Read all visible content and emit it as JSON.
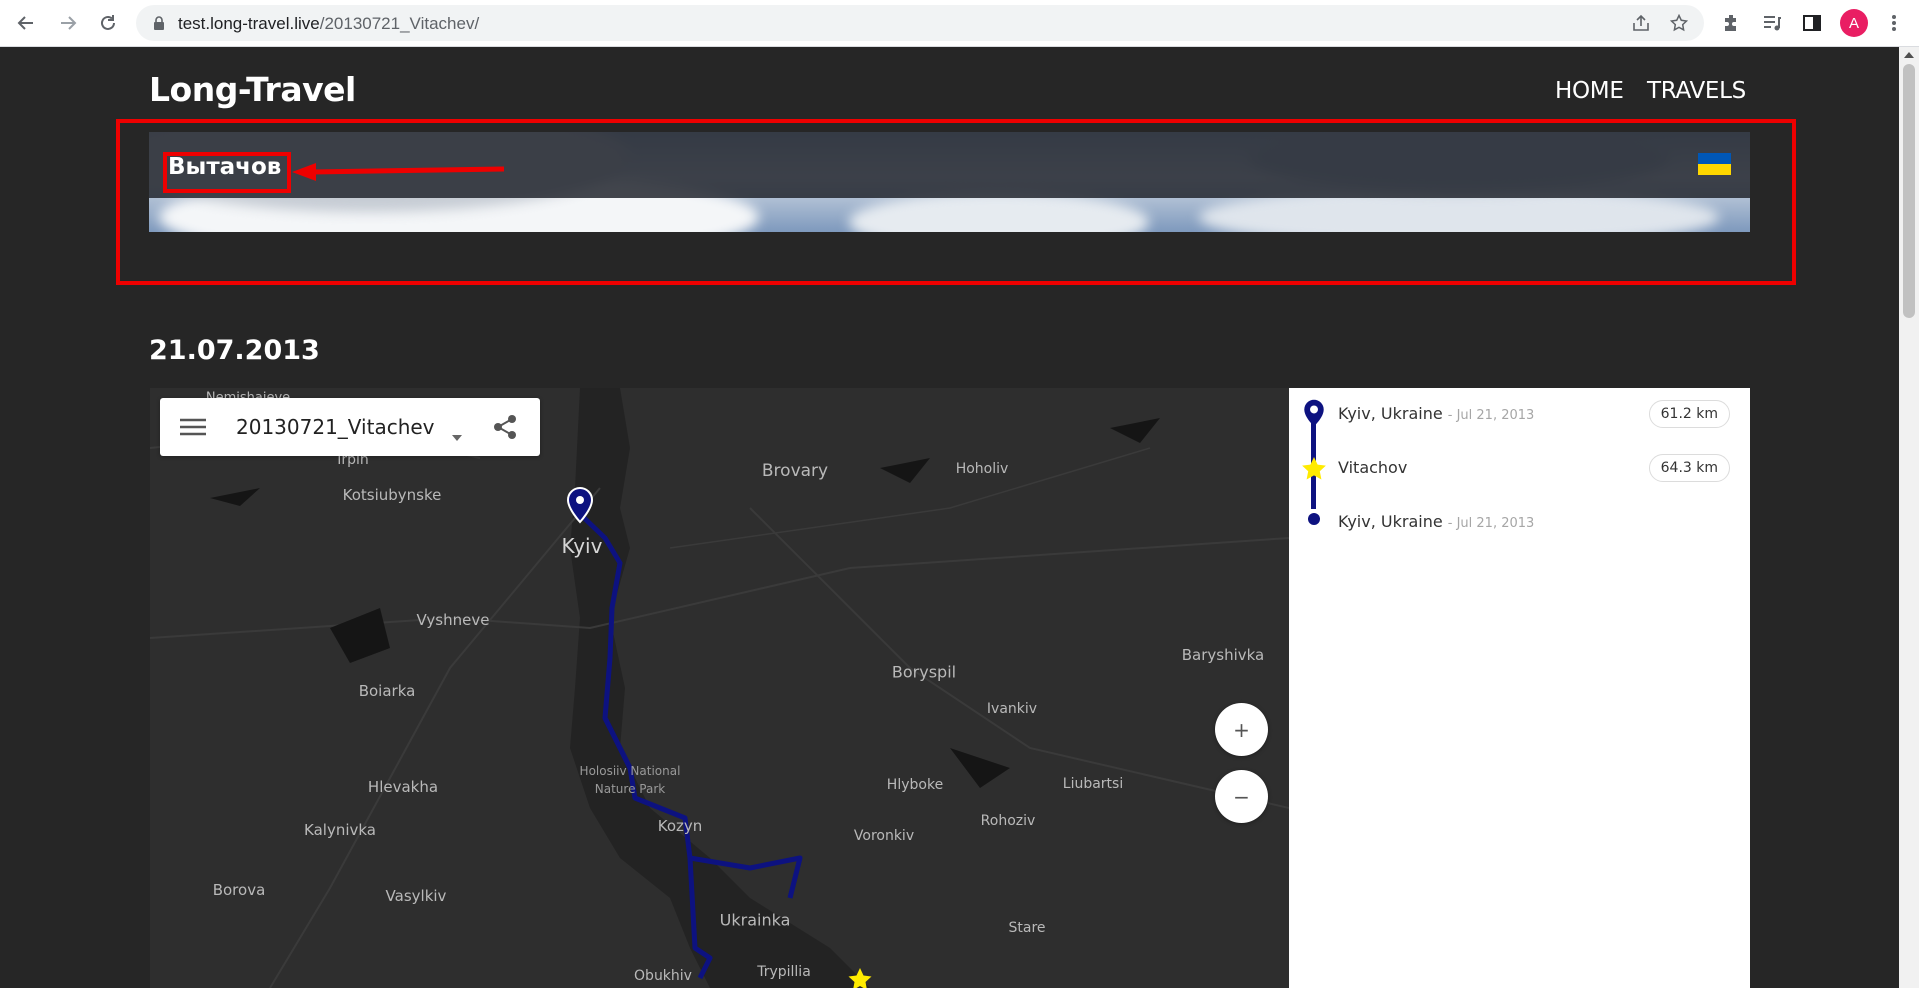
{
  "browser": {
    "url_host": "test.long-travel.live",
    "url_path": "/20130721_Vitachev/",
    "avatar_letter": "A"
  },
  "site": {
    "title": "Long-Travel",
    "nav": [
      "HOME",
      "TRAVELS"
    ]
  },
  "banner": {
    "title": "Вытачов",
    "flag": "ukraine-flag-icon"
  },
  "trip": {
    "date": "21.07.2013"
  },
  "map": {
    "panel_title": "20130721_Vitachev",
    "zoom_in": "+",
    "zoom_out": "−",
    "labels": {
      "nemishaieve": "Nemishaieve",
      "irpin": "Irpin",
      "kotsiubynske": "Kotsiubynske",
      "brovary": "Brovary",
      "hoholiv": "Hoholiv",
      "kyiv": "Kyiv",
      "vyshneve": "Vyshneve",
      "baryshivka": "Baryshivka",
      "boryspil": "Boryspil",
      "boiarka": "Boiarka",
      "ivankiv": "Ivankiv",
      "holosiiv": "Holosiiv National",
      "nature_park": "Nature Park",
      "hlevakha": "Hlevakha",
      "hlyboke": "Hlyboke",
      "liubartsi": "Liubartsi",
      "kalynivka": "Kalynivka",
      "kozyn": "Kozyn",
      "voronkiv": "Voronkiv",
      "rohoziv": "Rohoziv",
      "borova": "Borova",
      "vasylkiv": "Vasylkiv",
      "ukrainka": "Ukrainka",
      "stare": "Stare",
      "obukhiv": "Obukhiv",
      "trypillia": "Trypillia"
    }
  },
  "stops": [
    {
      "name": "Kyiv, Ukraine",
      "date": "- Jul 21, 2013",
      "distance": "61.2 km",
      "marker": "pin-icon"
    },
    {
      "name": "Vitachov",
      "date": "",
      "distance": "64.3 km",
      "marker": "star-icon"
    },
    {
      "name": "Kyiv, Ukraine",
      "date": "- Jul 21, 2013",
      "distance": "",
      "marker": "dot-icon"
    }
  ],
  "colors": {
    "page_bg": "#262626",
    "route": "#0d1280",
    "annotation": "#ee0000",
    "star": "#ffeb00"
  }
}
